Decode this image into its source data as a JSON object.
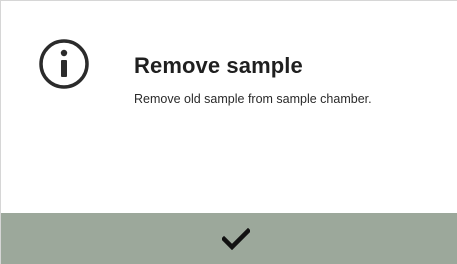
{
  "dialog": {
    "icon": "info-circle-icon",
    "title": "Remove sample",
    "message": "Remove old sample from sample chamber.",
    "confirm_icon": "checkmark-icon",
    "colors": {
      "background": "#ffffff",
      "text": "#1f1f1f",
      "confirm_bar": "#9ca89b",
      "icon": "#2b2b2b"
    }
  }
}
